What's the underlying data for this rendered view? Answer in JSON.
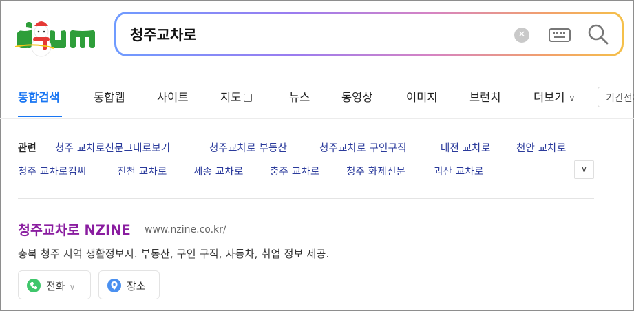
{
  "search": {
    "query": "청주교차로"
  },
  "tabs": [
    {
      "label": "통합검색"
    },
    {
      "label": "통합웹"
    },
    {
      "label": "사이트"
    },
    {
      "label": "지도"
    },
    {
      "label": "뉴스"
    },
    {
      "label": "동영상"
    },
    {
      "label": "이미지"
    },
    {
      "label": "브런치"
    },
    {
      "label": "더보기"
    }
  ],
  "period_filter": {
    "label": "기간전체"
  },
  "related": {
    "label": "관련",
    "items": [
      "청주 교차로신문그대로보기",
      "청주교차로 부동산",
      "청주교차로 구인구직",
      "대전 교차로",
      "천안 교차로",
      "청주 교차로컴씨",
      "진천 교차로",
      "세종 교차로",
      "충주 교차로",
      "청주 화제신문",
      "괴산 교차로"
    ]
  },
  "result": {
    "title": "청주교차로 NZINE",
    "url": "www.nzine.co.kr/",
    "description": "충북 청주 지역 생활정보지. 부동산, 구인 구직, 자동차, 취업 정보 제공.",
    "actions": [
      {
        "label": "전화"
      },
      {
        "label": "장소"
      }
    ]
  },
  "colors": {
    "active_tab": "#1976f3",
    "related_link": "#2a3a9b",
    "result_title": "#8a1da0",
    "phone_icon": "#3fc66b",
    "place_icon": "#4a90f0"
  },
  "icons": {
    "logo": "daum-logo-icon",
    "clear": "clear-icon",
    "keyboard": "keyboard-icon",
    "search": "search-icon",
    "map": "map-icon",
    "more": "chevron-down-icon",
    "phone": "phone-icon",
    "place": "location-pin-icon"
  }
}
